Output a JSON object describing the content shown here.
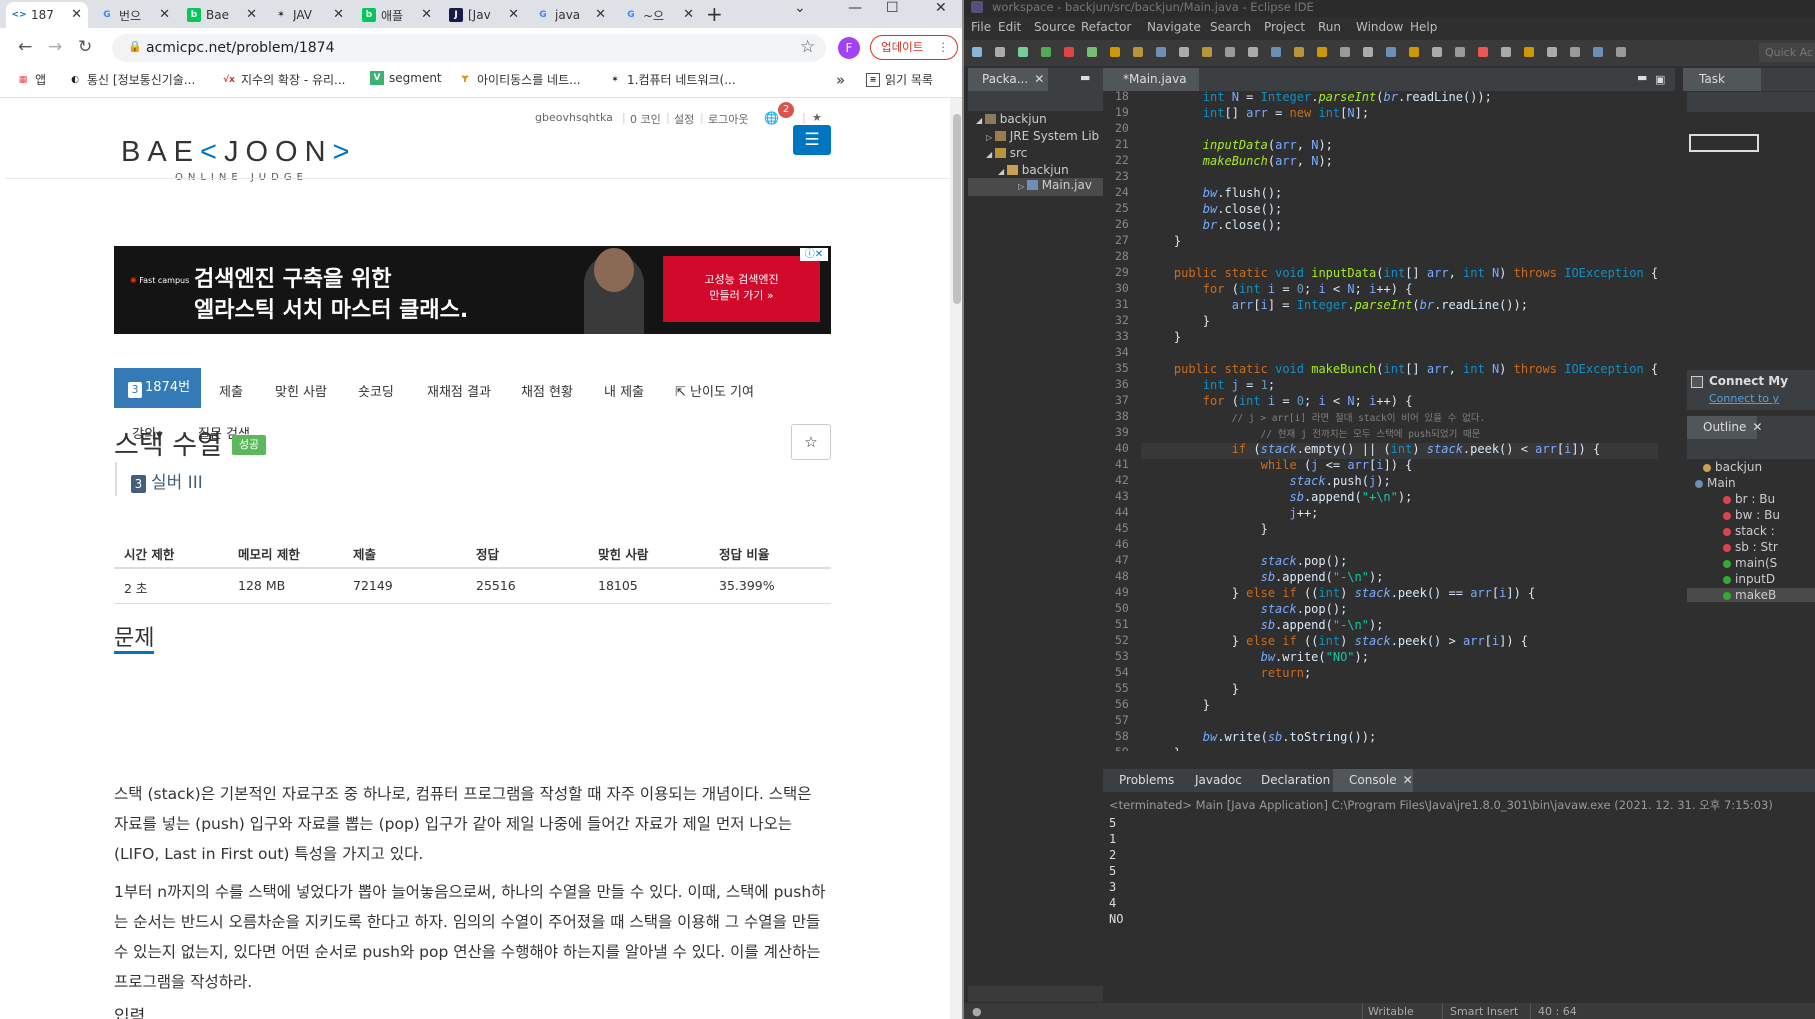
{
  "browser": {
    "tabs": [
      {
        "title": "187",
        "icon": "<>",
        "icon_color": "#0076c0",
        "icon_bg": "transparent",
        "active": true
      },
      {
        "title": "번으",
        "icon": "G",
        "icon_color": "#4285f4",
        "icon_bg": "transparent"
      },
      {
        "title": "Bae",
        "icon": "b",
        "icon_color": "#fff",
        "icon_bg": "#03c75a"
      },
      {
        "title": "JAV",
        "icon": "✶",
        "icon_color": "#222",
        "icon_bg": "transparent"
      },
      {
        "title": "애플",
        "icon": "b",
        "icon_color": "#fff",
        "icon_bg": "#03c75a"
      },
      {
        "title": "[Jav",
        "icon": "J",
        "icon_color": "#fff",
        "icon_bg": "#1a1a4a"
      },
      {
        "title": "java",
        "icon": "G",
        "icon_color": "#4285f4",
        "icon_bg": "transparent"
      },
      {
        "title": "~으",
        "icon": "G",
        "icon_color": "#4285f4",
        "icon_bg": "transparent"
      }
    ],
    "new_tab": "+",
    "window_controls": {
      "dropdown": "⌄",
      "minimize": "—",
      "maximize": "☐",
      "close": "✕"
    },
    "url": "acmicpc.net/problem/1874",
    "profile_initial": "F",
    "update_label": "업데이트",
    "bookmarks": [
      {
        "label": "앱",
        "icon": "▦",
        "icon_color": "#e44"
      },
      {
        "label": "통신 [정보통신기술...",
        "icon": "◐",
        "icon_color": "#222"
      },
      {
        "label": "지수의 확장 - 유리...",
        "icon": "√x",
        "icon_color": "#c33"
      },
      {
        "label": "segment",
        "icon": "V",
        "icon_color": "#fff",
        "icon_bg": "#3cb371"
      },
      {
        "label": "아이티동스를 네트...",
        "icon": "Ɏ",
        "icon_color": "#d80"
      },
      {
        "label": "1.컴퓨터 네트워크(...",
        "icon": "✶",
        "icon_color": "#222"
      }
    ],
    "bookmarks_more": "»",
    "reading_list": "읽기 목록"
  },
  "site": {
    "top_links": [
      "gbeovhsqhtka",
      "0 코인",
      "설정",
      "로그아웃"
    ],
    "notif_count": "2",
    "logo_main_a": "BAE",
    "logo_mark_a": "<",
    "logo_main_b": "JOON",
    "logo_mark_b": ">",
    "logo_sub": "ONLINE JUDGE",
    "ad": {
      "brand": "Fast campus",
      "line1": "검색엔진 구축을 위한",
      "line2": "엘라스틱 서치 마스터 클래스.",
      "cta": "고성능 검색엔진\n만들러 가기 »"
    },
    "problem_tabs": [
      "1874번",
      "제출",
      "맞힌 사람",
      "숏코딩",
      "재채점 결과",
      "채점 현황",
      "내 제출",
      "난이도 기여"
    ],
    "problem_tabs_row2": [
      "강의",
      "질문 검색"
    ],
    "problem_title": "스택 수열",
    "problem_badge": "성공",
    "tier_number": "3",
    "tier_label": "실버 III",
    "table_headers": [
      "시간 제한",
      "메모리 제한",
      "제출",
      "정답",
      "맞힌 사람",
      "정답 비율"
    ],
    "table_values": [
      "2 초",
      "128 MB",
      "72149",
      "25516",
      "18105",
      "35.399%"
    ],
    "section_title": "문제",
    "para1": "스택 (stack)은 기본적인 자료구조 중 하나로, 컴퓨터 프로그램을 작성할 때 자주 이용되는 개념이다. 스택은 자료를 넣는 (push) 입구와 자료를 뽑는 (pop) 입구가 같아 제일 나중에 들어간 자료가 제일 먼저 나오는 (LIFO, Last in First out) 특성을 가지고 있다.",
    "para2": "1부터 n까지의 수를 스택에 넣었다가 뽑아 늘어놓음으로써, 하나의 수열을 만들 수 있다. 이때, 스택에 push하는 순서는 반드시 오름차순을 지키도록 한다고 하자. 임의의 수열이 주어졌을 때 스택을 이용해 그 수열을 만들 수 있는지 없는지, 있다면 어떤 순서로 push와 pop 연산을 수행해야 하는지를 알아낼 수 있다. 이를 계산하는 프로그램을 작성하라.",
    "next_section": "입력"
  },
  "eclipse": {
    "title": "workspace - backjun/src/backjun/Main.java - Eclipse IDE",
    "menu": [
      "File",
      "Edit",
      "Source",
      "Refactor",
      "Navigate",
      "Search",
      "Project",
      "Run",
      "Window",
      "Help"
    ],
    "quick_access": "Quick Ac",
    "package_tab": "Packa...",
    "package_tree": [
      "backjun",
      "JRE System Lib",
      "src",
      "backjun",
      "Main.jav"
    ],
    "editor_tab": "*Main.java",
    "tasklist_tab": "Task List",
    "connect_title": "Connect My",
    "connect_link": "Connect to y",
    "outline_tab": "Outline",
    "outline_items": [
      "backjun",
      "Main",
      "br : Bu",
      "bw : Bu",
      "stack :",
      "sb : Str",
      "main(S",
      "inputD",
      "makeB"
    ],
    "code_lines": [
      {
        "n": "18",
        "html": "        <span class='ty'>int</span> <span class='va'>N</span> = <span class='ty'>Integer</span>.<span class='fn it'>parseInt</span>(<span class='va it'>br</span>.readLine());"
      },
      {
        "n": "19",
        "html": "        <span class='ty'>int</span>[] <span class='va'>arr</span> = <span class='kw'>new</span> <span class='ty'>int</span>[<span class='va'>N</span>];"
      },
      {
        "n": "20",
        "html": ""
      },
      {
        "n": "21",
        "html": "        <span class='fn it'>inputData</span>(<span class='va'>arr</span>, <span class='va'>N</span>);"
      },
      {
        "n": "22",
        "html": "        <span class='fn it'>makeBunch</span>(<span class='va'>arr</span>, <span class='va'>N</span>);"
      },
      {
        "n": "23",
        "html": ""
      },
      {
        "n": "24",
        "html": "        <span class='va it'>bw</span>.flush();"
      },
      {
        "n": "25",
        "html": "        <span class='va it'>bw</span>.close();"
      },
      {
        "n": "26",
        "html": "        <span class='va it'>br</span>.close();"
      },
      {
        "n": "27",
        "html": "    }"
      },
      {
        "n": "28",
        "html": ""
      },
      {
        "n": "29",
        "html": "    <span class='kw'>public</span> <span class='kw'>static</span> <span class='ty'>void</span> <span class='fn'>inputData</span>(<span class='ty'>int</span>[] <span class='va'>arr</span>, <span class='ty'>int</span> <span class='va'>N</span>) <span class='kw'>throws</span> <span class='ty'>IOException</span> {"
      },
      {
        "n": "30",
        "html": "        <span class='kw'>for</span> (<span class='ty'>int</span> <span class='va'>i</span> = <span class='nu'>0</span>; <span class='va'>i</span> &lt; <span class='va'>N</span>; <span class='va'>i</span>++) {"
      },
      {
        "n": "31",
        "html": "            <span class='va'>arr</span>[<span class='va'>i</span>] = <span class='ty'>Integer</span>.<span class='fn it'>parseInt</span>(<span class='va it'>br</span>.readLine());"
      },
      {
        "n": "32",
        "html": "        }"
      },
      {
        "n": "33",
        "html": "    }"
      },
      {
        "n": "34",
        "html": ""
      },
      {
        "n": "35",
        "html": "    <span class='kw'>public</span> <span class='kw'>static</span> <span class='ty'>void</span> <span class='fn'>makeBunch</span>(<span class='ty'>int</span>[] <span class='va'>arr</span>, <span class='ty'>int</span> <span class='va'>N</span>) <span class='kw'>throws</span> <span class='ty'>IOException</span> {"
      },
      {
        "n": "36",
        "html": "        <span class='ty'>int</span> <span class='va'>j</span> = <span class='nu'>1</span>;"
      },
      {
        "n": "37",
        "html": "        <span class='kw'>for</span> (<span class='ty'>int</span> <span class='va'>i</span> = <span class='nu'>0</span>; <span class='va'>i</span> &lt; <span class='va'>N</span>; <span class='va'>i</span>++) {"
      },
      {
        "n": "38",
        "html": "            <span class='cm'>// j > arr[i] 라면 절대 stack이 비어 있을 수 없다.</span>"
      },
      {
        "n": "39",
        "html": "                <span class='cm'>// 현재 j 전까지는 모두 스택에 push되었기 때문</span>"
      },
      {
        "n": "40",
        "html": "            <span class='kw'>if</span> (<span class='va it'>stack</span>.empty() || (<span class='ty'>int</span>) <span class='va it'>stack</span>.peek() &lt; <span class='va'>arr</span>[<span class='va'>i</span>]) {"
      },
      {
        "n": "41",
        "html": "                <span class='kw'>while</span> (<span class='va'>j</span> &lt;= <span class='va'>arr</span>[<span class='va'>i</span>]) {"
      },
      {
        "n": "42",
        "html": "                    <span class='va it'>stack</span>.push(<span class='va'>j</span>);"
      },
      {
        "n": "43",
        "html": "                    <span class='va it'>sb</span>.append(<span class='st'>\"+\\n\"</span>);"
      },
      {
        "n": "44",
        "html": "                    <span class='va'>j</span>++;"
      },
      {
        "n": "45",
        "html": "                }"
      },
      {
        "n": "46",
        "html": ""
      },
      {
        "n": "47",
        "html": "                <span class='va it'>stack</span>.pop();"
      },
      {
        "n": "48",
        "html": "                <span class='va it'>sb</span>.append(<span class='st'>\"-\\n\"</span>);"
      },
      {
        "n": "49",
        "html": "            } <span class='kw'>else</span> <span class='kw'>if</span> ((<span class='ty'>int</span>) <span class='va it'>stack</span>.peek() == <span class='va'>arr</span>[<span class='va'>i</span>]) {"
      },
      {
        "n": "50",
        "html": "                <span class='va it'>stack</span>.pop();"
      },
      {
        "n": "51",
        "html": "                <span class='va it'>sb</span>.append(<span class='st'>\"-\\n\"</span>);"
      },
      {
        "n": "52",
        "html": "            } <span class='kw'>else</span> <span class='kw'>if</span> ((<span class='ty'>int</span>) <span class='va it'>stack</span>.peek() &gt; <span class='va'>arr</span>[<span class='va'>i</span>]) {"
      },
      {
        "n": "53",
        "html": "                <span class='va it'>bw</span>.write(<span class='st'>\"NO\"</span>);"
      },
      {
        "n": "54",
        "html": "                <span class='kw'>return</span>;"
      },
      {
        "n": "55",
        "html": "            }"
      },
      {
        "n": "56",
        "html": "        }"
      },
      {
        "n": "57",
        "html": ""
      },
      {
        "n": "58",
        "html": "        <span class='va it'>bw</span>.write(<span class='va it'>sb</span>.toString());"
      },
      {
        "n": "59",
        "html": "    }"
      }
    ],
    "bottom_tabs": [
      "Problems",
      "Javadoc",
      "Declaration",
      "Console"
    ],
    "console_header": "<terminated> Main [Java Application] C:\\Program Files\\Java\\jre1.8.0_301\\bin\\javaw.exe (2021. 12. 31. 오후 7:15:03)",
    "console_lines": [
      "5",
      "1",
      "2",
      "5",
      "3",
      "4",
      "NO"
    ],
    "status": [
      "Writable",
      "Smart Insert",
      "40 : 64"
    ]
  }
}
